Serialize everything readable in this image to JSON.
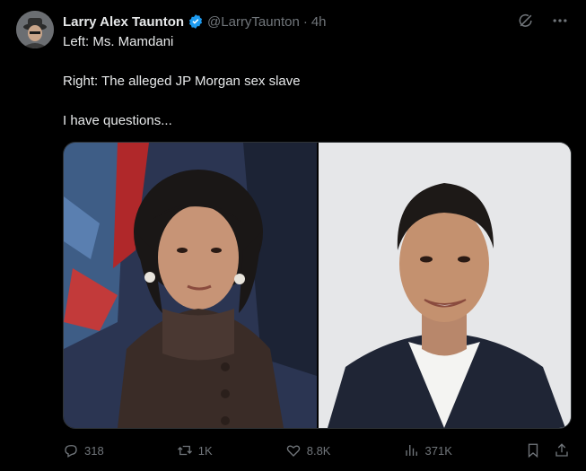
{
  "post": {
    "author_name": "Larry Alex Taunton",
    "handle": "@LarryTaunton",
    "separator": "·",
    "time": "4h",
    "text_lines": [
      "Left: Ms. Mamdani",
      "Right: The alleged JP Morgan sex slave",
      "I have questions..."
    ]
  },
  "actions": {
    "replies": "318",
    "reposts": "1K",
    "likes": "8.8K",
    "views": "371K"
  },
  "icons": {
    "verified": "verified-badge-icon",
    "grok": "grok-icon",
    "more": "more-icon",
    "reply": "reply-icon",
    "repost": "repost-icon",
    "like": "heart-icon",
    "views": "views-icon",
    "bookmark": "bookmark-icon",
    "share": "share-icon"
  },
  "colors": {
    "background": "#000000",
    "text": "#e7e9ea",
    "muted": "#71767b",
    "verified": "#1d9bf0"
  }
}
